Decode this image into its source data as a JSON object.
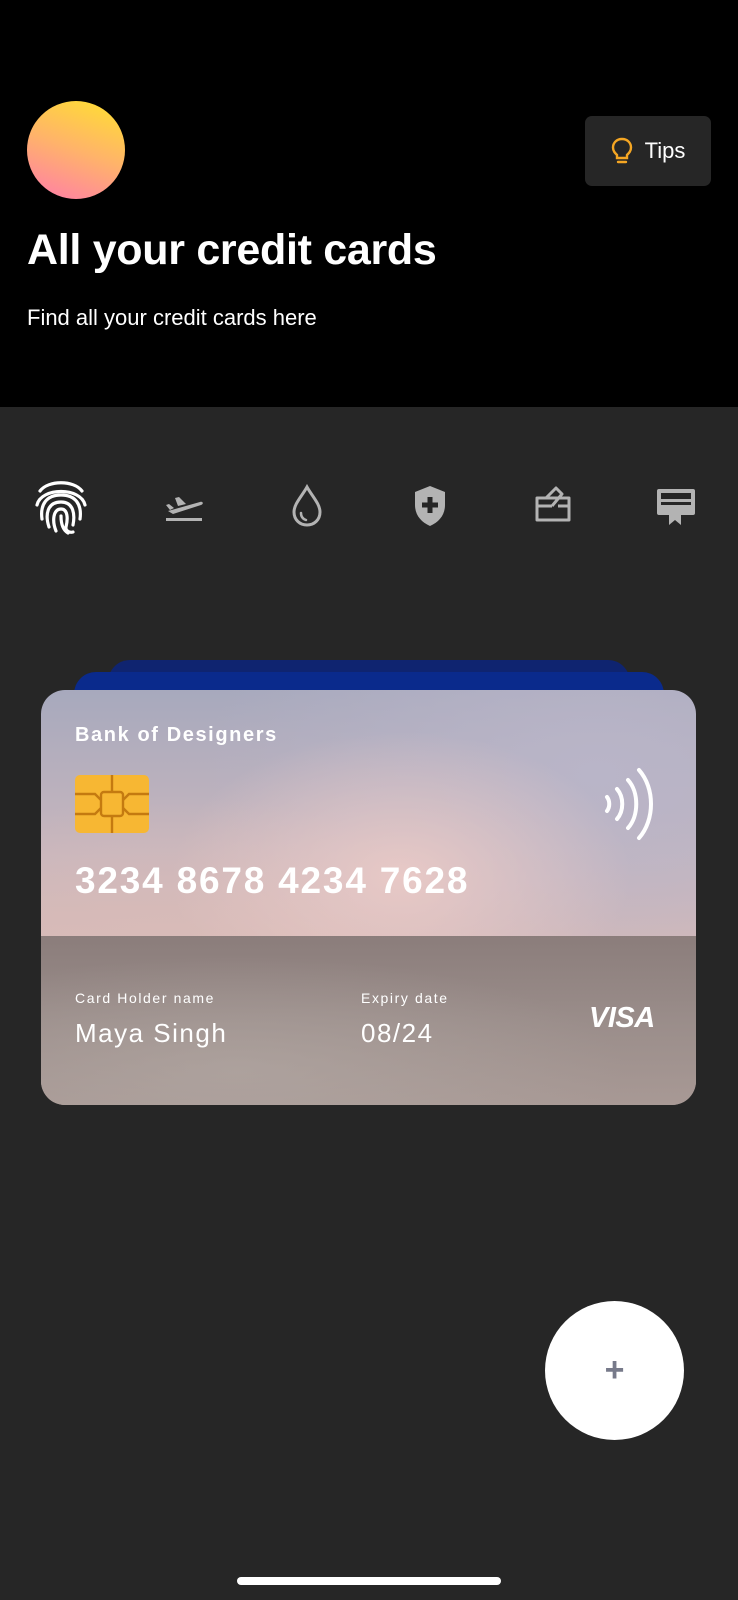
{
  "header": {
    "title": "All your credit cards",
    "subtitle": "Find all your credit cards here",
    "tips_label": "Tips",
    "tips_icon": "lightbulb-icon",
    "tips_icon_color": "#f5a623",
    "avatar_gradient": [
      "#ff7cab",
      "#ffe12f"
    ]
  },
  "categories": [
    {
      "name": "fingerprint-icon",
      "selected": true
    },
    {
      "name": "flight-takeoff-icon",
      "selected": false
    },
    {
      "name": "water-drop-icon",
      "selected": false
    },
    {
      "name": "health-shield-icon",
      "selected": false
    },
    {
      "name": "gift-card-icon",
      "selected": false
    },
    {
      "name": "loyalty-card-icon",
      "selected": false
    }
  ],
  "card": {
    "bank_name": "Bank of Designers",
    "number": "3234 8678 4234 7628",
    "holder_label": "Card Holder name",
    "holder_name": "Maya Singh",
    "expiry_label": "Expiry date",
    "expiry_value": "08/24",
    "network": "VISA"
  },
  "fab": {
    "label": "+",
    "icon": "plus-icon"
  },
  "colors": {
    "background": "#262626",
    "header_background": "#000000",
    "card_back_blue": "#0a2a8c"
  }
}
